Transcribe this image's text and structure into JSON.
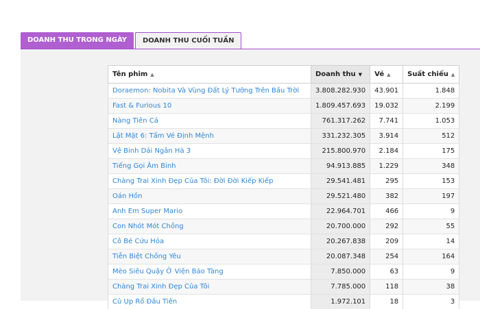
{
  "tabs": [
    {
      "label": "DOANH THU TRONG NGÀY"
    },
    {
      "label": "DOANH THU CUỐI TUẦN"
    }
  ],
  "table": {
    "headers": [
      "Tên phim",
      "Doanh thu",
      "Vé",
      "Suất chiếu"
    ],
    "rows": [
      {
        "title": "Doraemon: Nobita Và Vùng Đất Lý Tưởng Trên Bầu Trời",
        "revenue": "3.808.282.930",
        "tickets": "43.901",
        "shows": "1.848"
      },
      {
        "title": "Fast & Furious 10",
        "revenue": "1.809.457.693",
        "tickets": "19.032",
        "shows": "2.199"
      },
      {
        "title": "Nàng Tiên Cá",
        "revenue": "761.317.262",
        "tickets": "7.741",
        "shows": "1.053"
      },
      {
        "title": "Lật Mặt 6: Tấm Vé Định Mệnh",
        "revenue": "331.232.305",
        "tickets": "3.914",
        "shows": "512"
      },
      {
        "title": "Vệ Binh Dải Ngân Hà 3",
        "revenue": "215.800.970",
        "tickets": "2.184",
        "shows": "175"
      },
      {
        "title": "Tiếng Gọi Âm Binh",
        "revenue": "94.913.885",
        "tickets": "1.229",
        "shows": "348"
      },
      {
        "title": "Chàng Trai Xinh Đẹp Của Tôi: Đời Đời Kiếp Kiếp",
        "revenue": "29.541.481",
        "tickets": "295",
        "shows": "153"
      },
      {
        "title": "Oán Hồn",
        "revenue": "29.521.480",
        "tickets": "382",
        "shows": "197"
      },
      {
        "title": "Anh Em Super Mario",
        "revenue": "22.964.701",
        "tickets": "466",
        "shows": "9"
      },
      {
        "title": "Con Nhót Mót Chồng",
        "revenue": "20.700.000",
        "tickets": "292",
        "shows": "55"
      },
      {
        "title": "Cô Bé Cứu Hỏa",
        "revenue": "20.267.838",
        "tickets": "209",
        "shows": "14"
      },
      {
        "title": "Tiễn Biệt Chồng Yêu",
        "revenue": "20.087.348",
        "tickets": "254",
        "shows": "164"
      },
      {
        "title": "Mèo Siêu Quậy Ở Viện Bảo Tàng",
        "revenue": "7.850.000",
        "tickets": "63",
        "shows": "9"
      },
      {
        "title": "Chàng Trai Xinh Đẹp Của Tôi",
        "revenue": "7.785.000",
        "tickets": "118",
        "shows": "38"
      },
      {
        "title": "Củ Ụp Rổ Đầu Tiên",
        "revenue": "1.972.101",
        "tickets": "18",
        "shows": "3"
      }
    ]
  }
}
